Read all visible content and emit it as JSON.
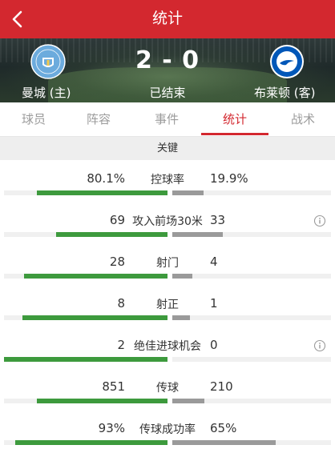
{
  "header": {
    "title": "统计"
  },
  "match": {
    "home_team": "曼城 (主)",
    "away_team": "布莱顿 (客)",
    "score": "2 - 0",
    "status": "已结束",
    "home_logo_text": "MANCHESTER CITY",
    "away_logo_text": "BRIGHTON & HOVE ALBION"
  },
  "tabs": [
    {
      "label": "球员",
      "active": false
    },
    {
      "label": "阵容",
      "active": false
    },
    {
      "label": "事件",
      "active": false
    },
    {
      "label": "统计",
      "active": true
    },
    {
      "label": "战术",
      "active": false
    }
  ],
  "section": {
    "title": "关键"
  },
  "stats": [
    {
      "label": "控球率",
      "home": "80.1%",
      "away": "19.9%",
      "home_ratio": 0.801,
      "away_ratio": 0.199,
      "info": false
    },
    {
      "label": "攻入前场30米",
      "home": "69",
      "away": "33",
      "home_ratio": 0.68,
      "away_ratio": 0.32,
      "info": true
    },
    {
      "label": "射门",
      "home": "28",
      "away": "4",
      "home_ratio": 0.875,
      "away_ratio": 0.125,
      "info": false
    },
    {
      "label": "射正",
      "home": "8",
      "away": "1",
      "home_ratio": 0.889,
      "away_ratio": 0.111,
      "info": false
    },
    {
      "label": "绝佳进球机会",
      "home": "2",
      "away": "0",
      "home_ratio": 1.0,
      "away_ratio": 0.0,
      "info": true
    },
    {
      "label": "传球",
      "home": "851",
      "away": "210",
      "home_ratio": 0.8,
      "away_ratio": 0.2,
      "info": false
    },
    {
      "label": "传球成功率",
      "home": "93%",
      "away": "65%",
      "home_ratio": 0.93,
      "away_ratio": 0.65,
      "info": false
    }
  ],
  "colors": {
    "accent": "#d3282f",
    "home_bar": "#3d9a3d",
    "away_bar": "#9a9a9a",
    "man_city_blue": "#6cabdd",
    "brighton_blue": "#0057b8"
  }
}
